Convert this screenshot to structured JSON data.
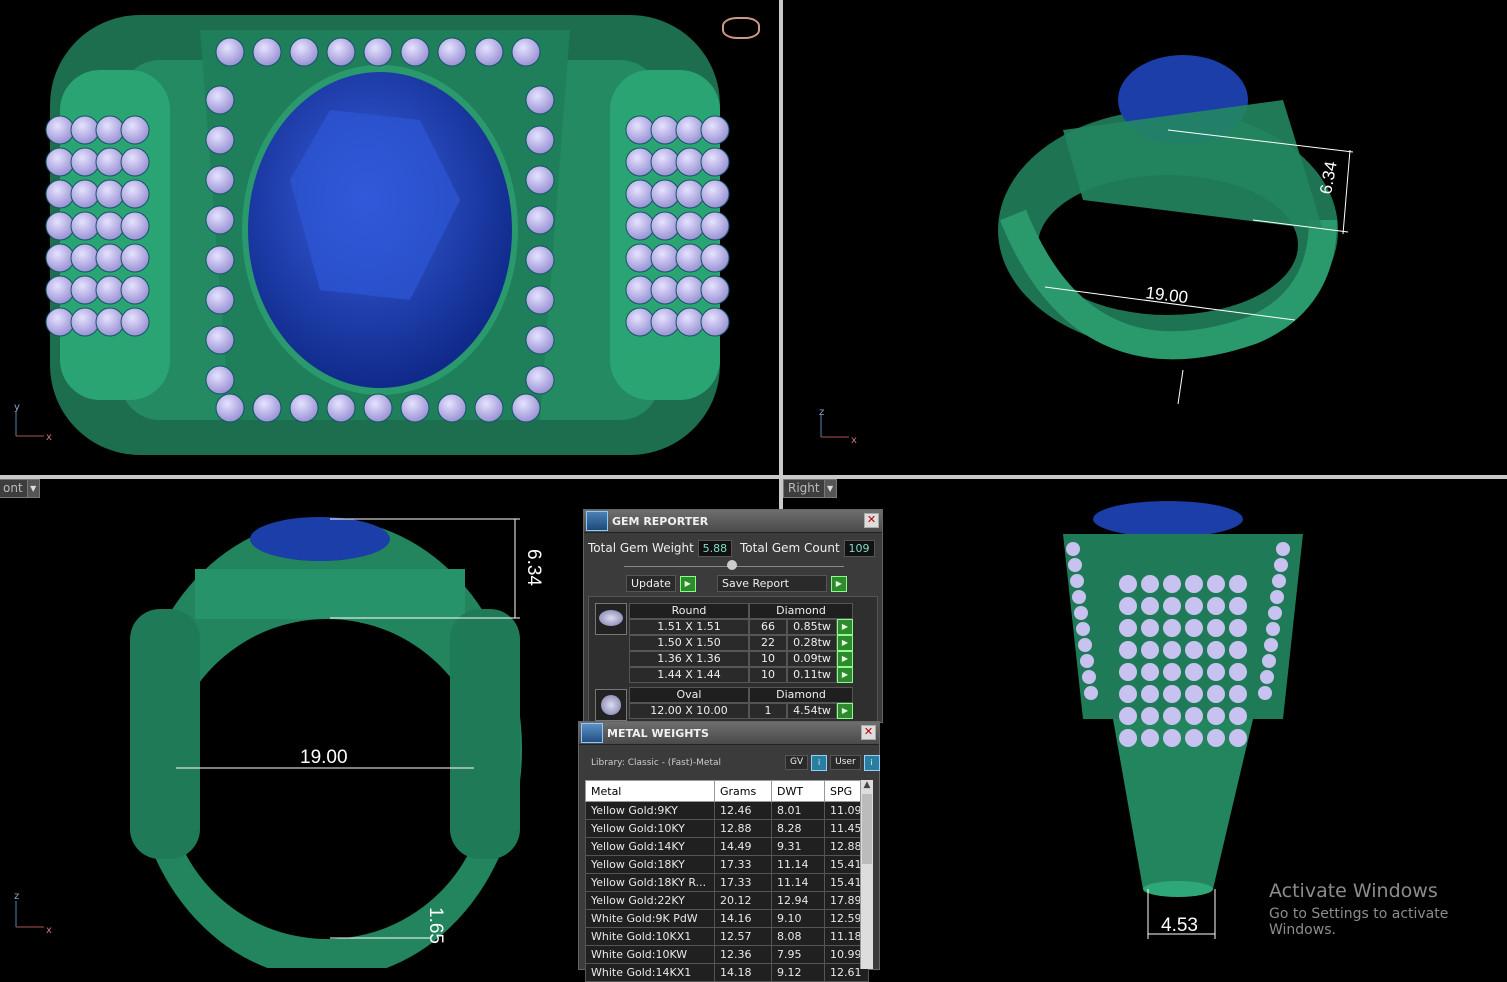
{
  "viewports": {
    "top_right_dimensions": {
      "height": "6.34",
      "width": "19.00"
    },
    "bottom_left": {
      "label": "ont",
      "dimensions": {
        "height": "6.34",
        "inner": "19.00",
        "shank": "1.65"
      }
    },
    "bottom_right": {
      "label": "Right",
      "dimensions": {
        "shank": "4.53"
      }
    }
  },
  "axes": {
    "x": "x",
    "y": "y",
    "z": "z"
  },
  "gem_reporter": {
    "title": "GEM REPORTER",
    "total_weight_label": "Total Gem Weight",
    "total_weight_value": "5.88",
    "total_count_label": "Total Gem Count",
    "total_count_value": "109",
    "update_label": "Update",
    "save_label": "Save Report",
    "groups": [
      {
        "shape": "Round",
        "material": "Diamond",
        "rows": [
          {
            "size": "1.51 X 1.51",
            "count": "66",
            "weight": "0.85tw"
          },
          {
            "size": "1.50 X 1.50",
            "count": "22",
            "weight": "0.28tw"
          },
          {
            "size": "1.36 X 1.36",
            "count": "10",
            "weight": "0.09tw"
          },
          {
            "size": "1.44 X 1.44",
            "count": "10",
            "weight": "0.11tw"
          }
        ]
      },
      {
        "shape": "Oval",
        "material": "Diamond",
        "rows": [
          {
            "size": "12.00 X 10.00",
            "count": "1",
            "weight": "4.54tw"
          }
        ]
      }
    ]
  },
  "metal_weights": {
    "title": "METAL WEIGHTS",
    "library": "Library: Classic - (Fast)-Metal",
    "gv_label": "GV",
    "user_label": "User",
    "columns": [
      "Metal",
      "Grams",
      "DWT",
      "SPG"
    ],
    "rows": [
      [
        "Yellow Gold:9KY",
        "12.46",
        "8.01",
        "11.09"
      ],
      [
        "Yellow Gold:10KY",
        "12.88",
        "8.28",
        "11.45"
      ],
      [
        "Yellow Gold:14KY",
        "14.49",
        "9.31",
        "12.88"
      ],
      [
        "Yellow Gold:18KY",
        "17.33",
        "11.14",
        "15.41"
      ],
      [
        "Yellow Gold:18KY R...",
        "17.33",
        "11.14",
        "15.41"
      ],
      [
        "Yellow Gold:22KY",
        "20.12",
        "12.94",
        "17.89"
      ],
      [
        "White Gold:9K PdW",
        "14.16",
        "9.10",
        "12.59"
      ],
      [
        "White Gold:10KX1",
        "12.57",
        "8.08",
        "11.18"
      ],
      [
        "White Gold:10KW",
        "12.36",
        "7.95",
        "10.99"
      ],
      [
        "White Gold:14KX1",
        "14.18",
        "9.12",
        "12.61"
      ]
    ]
  },
  "watermark": {
    "line1": "Activate Windows",
    "line2": "Go to Settings to activate Windows."
  },
  "colors": {
    "metal": "#1f7a58",
    "metal_light": "#2fa878",
    "gem": "#1b3ea8",
    "diamond": "#b8b2e6"
  }
}
